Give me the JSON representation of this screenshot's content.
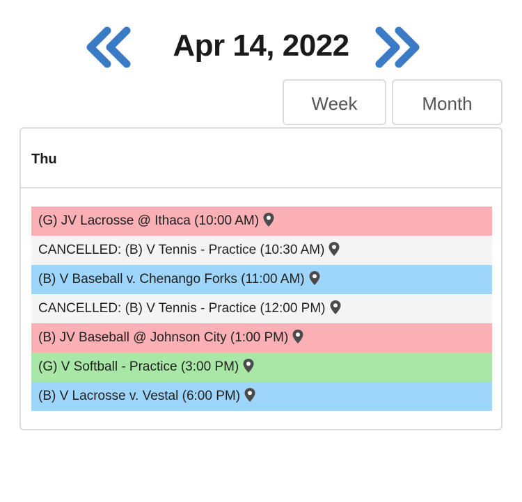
{
  "header": {
    "date_title": "Apr 14, 2022",
    "prev_icon": "double-chevron-left-icon",
    "next_icon": "double-chevron-right-icon",
    "accent_color": "#3b7bc6"
  },
  "views": {
    "week_label": "Week",
    "month_label": "Month"
  },
  "day": {
    "label": "Thu"
  },
  "events": [
    {
      "title": "(G) JV Lacrosse @ Ithaca (10:00 AM)",
      "color": "#fab0b4",
      "icon": "map-pin-icon"
    },
    {
      "title": "CANCELLED: (B) V Tennis - Practice (10:30 AM)",
      "color": "#f4f4f4",
      "icon": "map-pin-icon"
    },
    {
      "title": "(B) V Baseball v. Chenango Forks (11:00 AM)",
      "color": "#9ed5fb",
      "icon": "map-pin-icon"
    },
    {
      "title": "CANCELLED: (B) V Tennis - Practice (12:00 PM)",
      "color": "#f4f4f4",
      "icon": "map-pin-icon"
    },
    {
      "title": "(B) JV Baseball @ Johnson City (1:00 PM)",
      "color": "#fab0b4",
      "icon": "map-pin-icon"
    },
    {
      "title": "(G) V Softball - Practice (3:00 PM)",
      "color": "#a8e7a6",
      "icon": "map-pin-icon"
    },
    {
      "title": "(B) V Lacrosse v. Vestal (6:00 PM)",
      "color": "#9ed5fb",
      "icon": "map-pin-icon"
    }
  ]
}
